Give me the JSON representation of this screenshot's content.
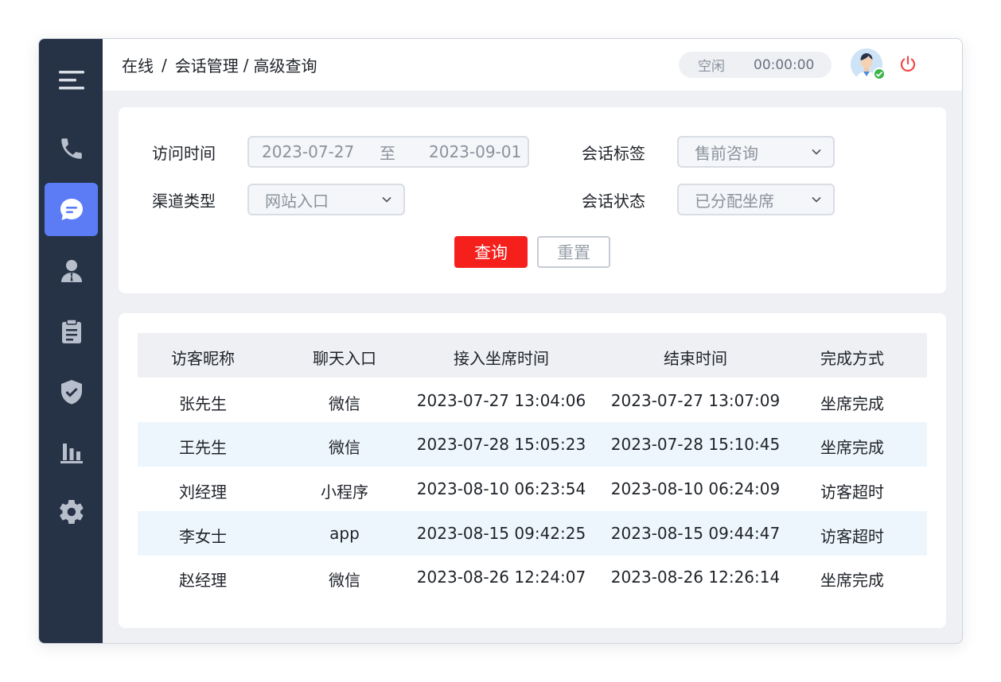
{
  "header": {
    "breadcrumb": [
      "在线",
      "会话管理",
      "高级查询"
    ],
    "status": "空闲",
    "timer": "00:00:00"
  },
  "sidebar": {
    "items": [
      {
        "icon": "menu-icon"
      },
      {
        "icon": "phone-icon"
      },
      {
        "icon": "chat-icon",
        "active": true
      },
      {
        "icon": "agent-icon"
      },
      {
        "icon": "clipboard-icon"
      },
      {
        "icon": "shield-icon"
      },
      {
        "icon": "bar-chart-icon"
      },
      {
        "icon": "gear-icon"
      }
    ]
  },
  "filters": {
    "visit_time_label": "访问时间",
    "date_start": "2023-07-27",
    "date_to": "至",
    "date_end": "2023-09-01",
    "tag_label": "会话标签",
    "tag_value": "售前咨询",
    "channel_label": "渠道类型",
    "channel_value": "网站入口",
    "status_label": "会话状态",
    "status_value": "已分配坐席",
    "query_button": "查询",
    "reset_button": "重置"
  },
  "table": {
    "columns": [
      "访客昵称",
      "聊天入口",
      "接入坐席时间",
      "结束时间",
      "完成方式"
    ],
    "rows": [
      [
        "张先生",
        "微信",
        "2023-07-27 13:04:06",
        "2023-07-27 13:07:09",
        "坐席完成"
      ],
      [
        "王先生",
        "微信",
        "2023-07-28 15:05:23",
        "2023-07-28 15:10:45",
        "坐席完成"
      ],
      [
        "刘经理",
        "小程序",
        "2023-08-10 06:23:54",
        "2023-08-10 06:24:09",
        "访客超时"
      ],
      [
        "李女士",
        "app",
        "2023-08-15 09:42:25",
        "2023-08-15 09:44:47",
        "访客超时"
      ],
      [
        "赵经理",
        "微信",
        "2023-08-26 12:24:07",
        "2023-08-26 12:26:14",
        "坐席完成"
      ]
    ]
  },
  "colors": {
    "sidebar_bg": "#263245",
    "active_item": "#5b7cf5",
    "primary_button": "#f5201c",
    "online_badge": "#3cb54a",
    "stripe": "#eef6fd"
  }
}
